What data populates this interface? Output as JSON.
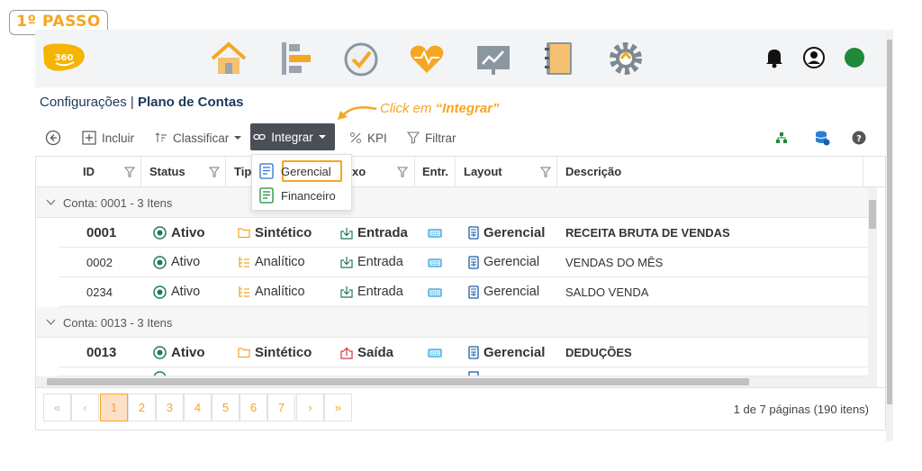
{
  "step_label": "1º PASSO",
  "breadcrumb": {
    "section": "Configurações",
    "separator": "|",
    "page": "Plano de Contas"
  },
  "callout": {
    "prefix": "Click em ",
    "quoted": "“Integrar”"
  },
  "nav_icons": [
    "home-icon",
    "hierarchy-icon",
    "check-clock-icon",
    "heart-pulse-icon",
    "presentation-chart-icon",
    "notebook-icon",
    "gear-icon"
  ],
  "toolbar": {
    "back_icon": "back-arrow-icon",
    "incluir": "Incluir",
    "classificar": "Classificar",
    "integrar": "Integrar",
    "kpi": "KPI",
    "filtrar": "Filtrar"
  },
  "dropdown": {
    "items": [
      "Gerencial",
      "Financeiro"
    ]
  },
  "columns": {
    "id": "ID",
    "status": "Status",
    "tipo": "Tip",
    "fluxo": "xo",
    "entr": "Entr.",
    "layout": "Layout",
    "descricao": "Descrição"
  },
  "groups": [
    {
      "label": "Conta: 0001 - 3 Itens"
    },
    {
      "label": "Conta: 0013 - 3 Itens"
    }
  ],
  "rows": [
    {
      "id": "0001",
      "status": "Ativo",
      "tipo": "Sintético",
      "fluxo": "Entrada",
      "layout": "Gerencial",
      "descricao": "RECEITA BRUTA DE VENDAS"
    },
    {
      "id": "0002",
      "status": "Ativo",
      "tipo": "Analítico",
      "fluxo": "Entrada",
      "layout": "Gerencial",
      "descricao": "VENDAS DO MÊS"
    },
    {
      "id": "0234",
      "status": "Ativo",
      "tipo": "Analítico",
      "fluxo": "Entrada",
      "layout": "Gerencial",
      "descricao": "SALDO VENDA"
    },
    {
      "id": "0013",
      "status": "Ativo",
      "tipo": "Sintético",
      "fluxo": "Saída",
      "layout": "Gerencial",
      "descricao": "DEDUÇÕES"
    }
  ],
  "pager": {
    "first": "«",
    "prev": "‹",
    "pages": [
      "1",
      "2",
      "3",
      "4",
      "5",
      "6",
      "7"
    ],
    "next": "›",
    "last": "»",
    "current": "1",
    "info": "1 de 7 páginas (190 itens)"
  },
  "colors": {
    "accent": "#f5a623",
    "active_status": "#1e7a4f",
    "green_dot": "#1e8a3a"
  }
}
